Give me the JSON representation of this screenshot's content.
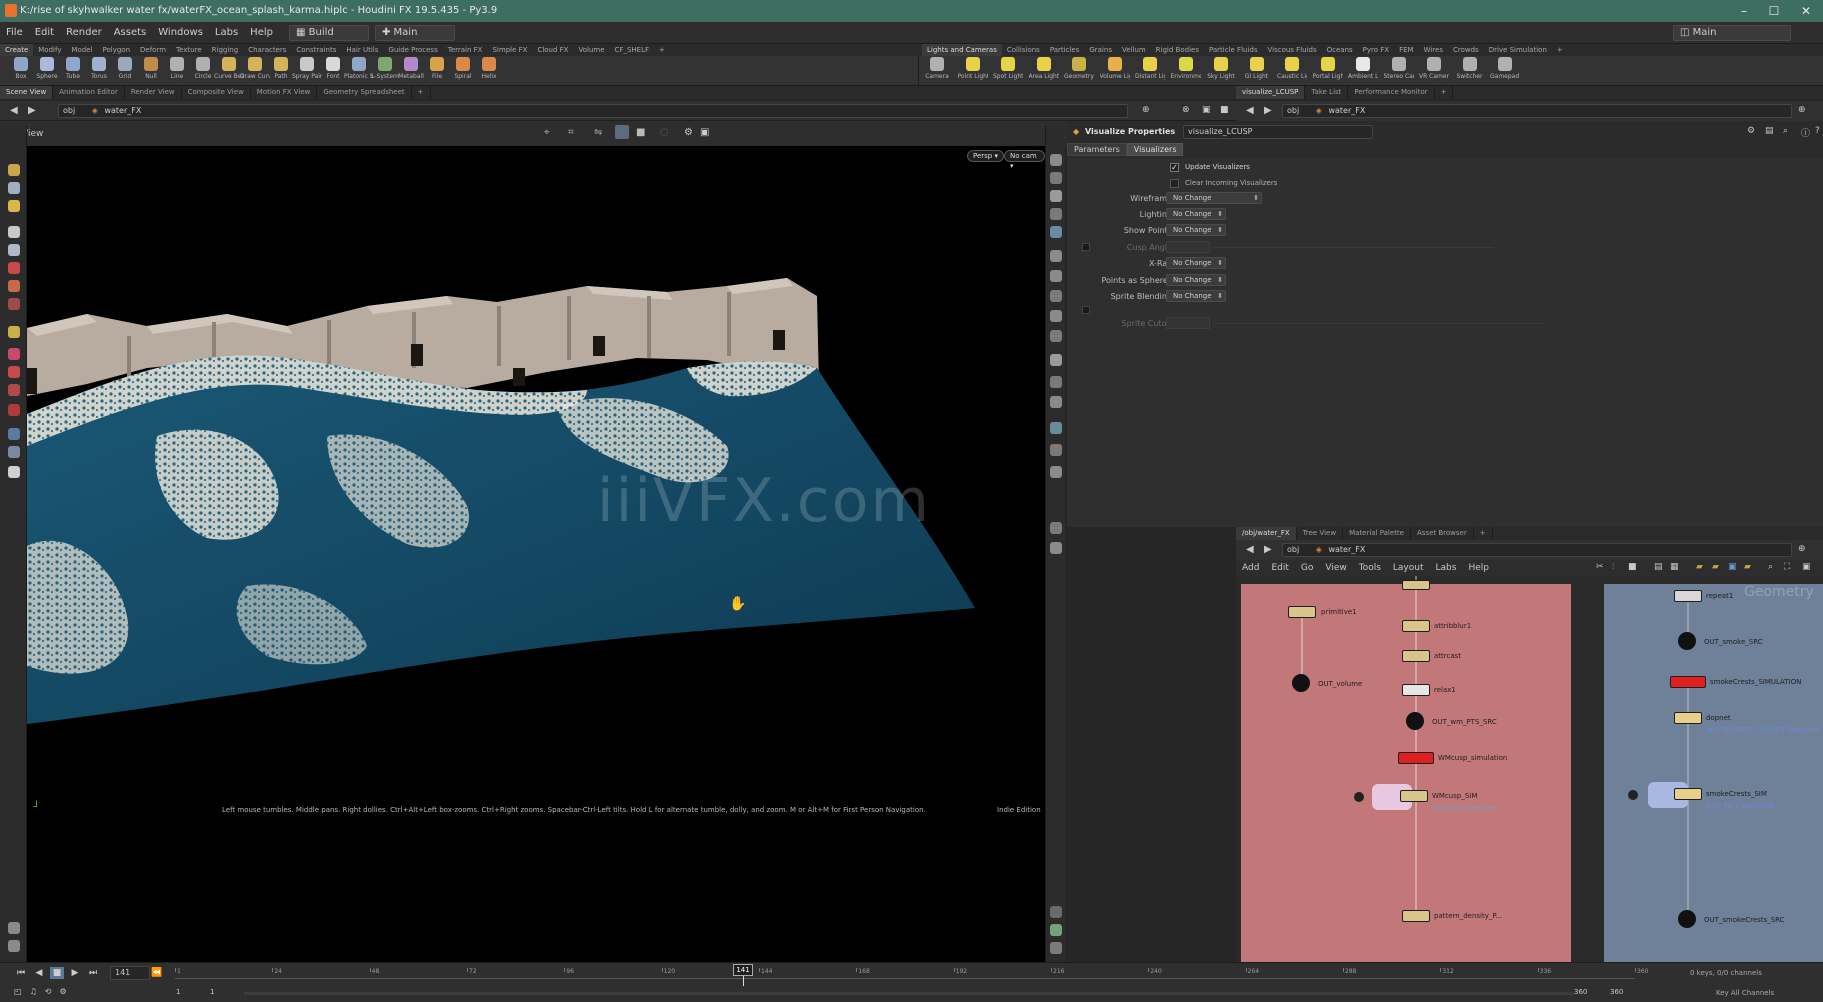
{
  "window": {
    "title": "K:/rise of skyhwalker water fx/waterFX_ocean_splash_karma.hiplc - Houdini FX 19.5.435 - Py3.9",
    "controls": [
      "minimize-icon",
      "maximize-icon",
      "close-icon"
    ]
  },
  "menu": {
    "items": [
      "File",
      "Edit",
      "Render",
      "Assets",
      "Windows",
      "Labs",
      "Help"
    ],
    "desktop": "Build",
    "desktop_icon": "grid-icon",
    "context": "Main",
    "right_context": "Main"
  },
  "shelf_tabs_left": [
    "Create",
    "Modify",
    "Model",
    "Polygon",
    "Deform",
    "Texture",
    "Rigging",
    "Characters",
    "Constraints",
    "Hair Utils",
    "Guide Process",
    "Terrain FX",
    "Simple FX",
    "Cloud FX",
    "Volume",
    "CF_SHELF"
  ],
  "shelf_tabs_right": [
    "Lights and Cameras",
    "Collisions",
    "Particles",
    "Grains",
    "Vellum",
    "Rigid Bodies",
    "Particle Fluids",
    "Viscous Fluids",
    "Oceans",
    "Pyro FX",
    "FEM",
    "Wires",
    "Crowds",
    "Drive Simulation"
  ],
  "shelf_tools_left": [
    {
      "label": "Box",
      "color": "#8fa6c9"
    },
    {
      "label": "Sphere",
      "color": "#a8bcd8"
    },
    {
      "label": "Tube",
      "color": "#8fa6c9"
    },
    {
      "label": "Torus",
      "color": "#9fb3d1"
    },
    {
      "label": "Grid",
      "color": "#9aa9b8"
    },
    {
      "label": "Null",
      "color": "#c08a4a"
    },
    {
      "label": "Line",
      "color": "#b0b0b0"
    },
    {
      "label": "Circle",
      "color": "#b0b0b0"
    },
    {
      "label": "Curve Bezier",
      "color": "#d3b45a"
    },
    {
      "label": "Draw Curve",
      "color": "#d3b45a"
    },
    {
      "label": "Path",
      "color": "#d3b45a"
    },
    {
      "label": "Spray Paint",
      "color": "#c9c9c9"
    },
    {
      "label": "Font",
      "color": "#d9d9d9"
    },
    {
      "label": "Platonic Solids",
      "color": "#8fa6c9"
    },
    {
      "label": "L-System",
      "color": "#7fa86f"
    },
    {
      "label": "Metaball",
      "color": "#b08ac9"
    },
    {
      "label": "File",
      "color": "#d9a24a"
    },
    {
      "label": "Spiral",
      "color": "#d98a4a"
    },
    {
      "label": "Helix",
      "color": "#d98a4a"
    }
  ],
  "shelf_tools_right": [
    {
      "label": "Camera",
      "color": "#b0b0b0"
    },
    {
      "label": "Point Light",
      "color": "#e8d24a"
    },
    {
      "label": "Spot Light",
      "color": "#e8d24a"
    },
    {
      "label": "Area Light",
      "color": "#e8d24a"
    },
    {
      "label": "Geometry Light",
      "color": "#c9b24a"
    },
    {
      "label": "Volume Light",
      "color": "#e8b04a"
    },
    {
      "label": "Distant Light",
      "color": "#e8d24a"
    },
    {
      "label": "Environment Light",
      "color": "#d9d94a"
    },
    {
      "label": "Sky Light",
      "color": "#e8d24a"
    },
    {
      "label": "GI Light",
      "color": "#e8d24a"
    },
    {
      "label": "Caustic Light",
      "color": "#e8d24a"
    },
    {
      "label": "Portal Light",
      "color": "#e8d24a"
    },
    {
      "label": "Ambient Light",
      "color": "#e8e8e8"
    },
    {
      "label": "Stereo Camera",
      "color": "#b0b0b0"
    },
    {
      "label": "VR Camera",
      "color": "#b0b0b0"
    },
    {
      "label": "Switcher",
      "color": "#b0b0b0"
    },
    {
      "label": "Gamepad Camera",
      "color": "#b0b0b0"
    }
  ],
  "viewer_tabs": [
    "Scene View",
    "Animation Editor",
    "Render View",
    "Composite View",
    "Motion FX View",
    "Geometry Spreadsheet"
  ],
  "viewer_path": {
    "root": "obj",
    "node": "water_FX"
  },
  "viewer": {
    "label": "View",
    "persp": "Persp",
    "cam": "No cam",
    "status": "Left mouse tumbles. Middle pans. Right dollies. Ctrl+Alt+Left box-zooms. Ctrl+Right zooms. Spacebar-Ctrl-Left tilts. Hold L for alternate tumble, dolly, and zoom.    M or Alt+M for First Person Navigation.",
    "edition": "Indie Edition",
    "watermark": "iiiVFX.com",
    "ocean_color": "#144a66",
    "foam_color": "#e4e0d4",
    "building_color": "#b8aca0"
  },
  "param_tabs": [
    "visualize_LCUSP",
    "Take List",
    "Performance Monitor"
  ],
  "param_path": {
    "root": "obj",
    "node": "water_FX"
  },
  "params": {
    "header": "Visualize Properties",
    "node_name": "visualize_LCUSP",
    "subtabs": [
      "Parameters",
      "Visualizers"
    ],
    "update_visualizers": "Update Visualizers",
    "clear_incoming": "Clear Incoming Visualizers",
    "rows": [
      {
        "label": "Wireframe",
        "value": "No Change"
      },
      {
        "label": "Lighting",
        "value": "No Change"
      },
      {
        "label": "Show Points",
        "value": "No Change"
      },
      {
        "label": "Cusp Angle",
        "value": ""
      },
      {
        "label": "X-Ray",
        "value": "No Change"
      },
      {
        "label": "Points as Spheres",
        "value": "No Change"
      },
      {
        "label": "Sprite Blending",
        "value": "No Change"
      },
      {
        "label": "Sprite Cutoff",
        "value": ""
      }
    ]
  },
  "network_tabs": [
    "/obj/water_FX",
    "Tree View",
    "Material Palette",
    "Asset Browser"
  ],
  "network_path": {
    "root": "obj",
    "node": "water_FX"
  },
  "network_menu": [
    "Add",
    "Edit",
    "Go",
    "View",
    "Tools",
    "Layout",
    "Labs",
    "Help"
  ],
  "network": {
    "watermark": "Geometry",
    "left_box_color": "#c27878",
    "right_box_color": "#6f8199",
    "nodes_left": [
      "primitive1",
      "OUT_volume"
    ],
    "nodes_center": [
      "attribblur1",
      "attrcast",
      "relax1",
      "OUT_wm_PTS_SRC",
      "WMcusp_simulation",
      "WMcusp_SIM",
      "pattern_density_P..."
    ],
    "center_note": "WMcusp Specified",
    "nodes_right": [
      "repeat1",
      "OUT_smoke_SRC",
      "smokeCrests_SIMULATION",
      "dopnet",
      "smokeCrests_SIM",
      "OUT_smokeCrests_SRC"
    ],
    "right_note1": "WHITEWATER_SOURCE Specified",
    "right_note2": "DOP_NET Specified"
  },
  "timeline": {
    "frame": "141",
    "start": "1",
    "start2": "1",
    "end": "360",
    "end2": "360",
    "current_marker": "141",
    "ticks": [
      "1",
      "24",
      "48",
      "72",
      "96",
      "120",
      "144",
      "168",
      "192",
      "216",
      "240",
      "264",
      "288",
      "312",
      "336",
      "360"
    ],
    "keys": "0 keys, 0/0 channels",
    "key_all": "Key All Channels"
  }
}
